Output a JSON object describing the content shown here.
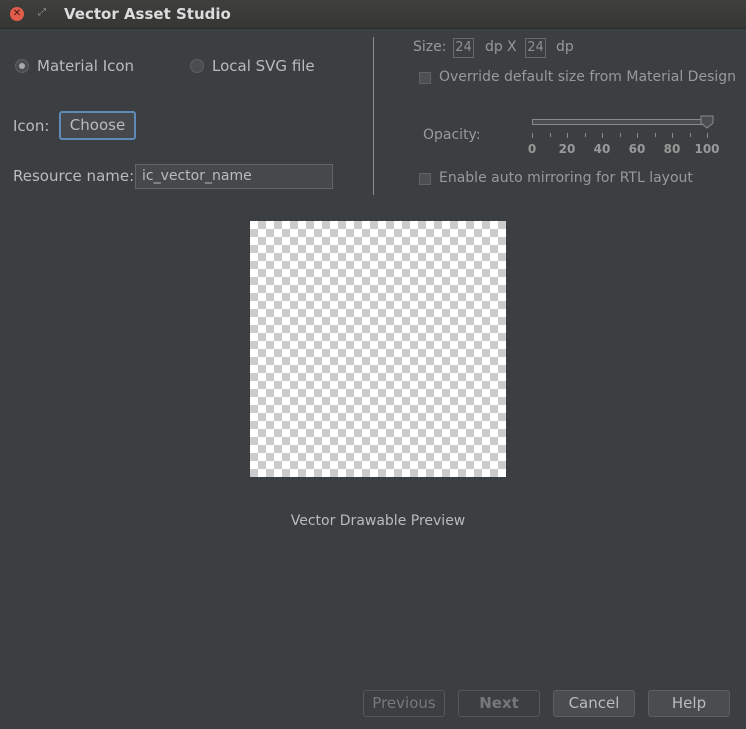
{
  "window": {
    "title": "Vector Asset Studio",
    "close_glyph": "✕",
    "restore_glyph": "⤢"
  },
  "source": {
    "options": [
      {
        "label": "Material Icon",
        "checked": true
      },
      {
        "label": "Local SVG file",
        "checked": false
      }
    ]
  },
  "icon": {
    "label": "Icon:",
    "choose_label": "Choose"
  },
  "resource": {
    "label": "Resource name:",
    "value": "ic_vector_name"
  },
  "size": {
    "label": "Size:",
    "width": "24",
    "width_unit": "dp",
    "separator": "X",
    "height": "24",
    "height_unit": "dp"
  },
  "override": {
    "label": "Override default size from Material Design",
    "checked": false
  },
  "opacity": {
    "label": "Opacity:",
    "value": 100,
    "min": 0,
    "max": 100,
    "tick_labels": [
      "0",
      "20",
      "40",
      "60",
      "80",
      "100"
    ]
  },
  "auto_mirror": {
    "label": "Enable auto mirroring for RTL layout",
    "checked": false
  },
  "preview": {
    "label": "Vector Drawable Preview"
  },
  "footer": {
    "previous": "Previous",
    "next": "Next",
    "cancel": "Cancel",
    "help": "Help"
  },
  "colors": {
    "background": "#3c3f41",
    "focus_border": "#5f8ab8",
    "close_button": "#e25c4b"
  }
}
